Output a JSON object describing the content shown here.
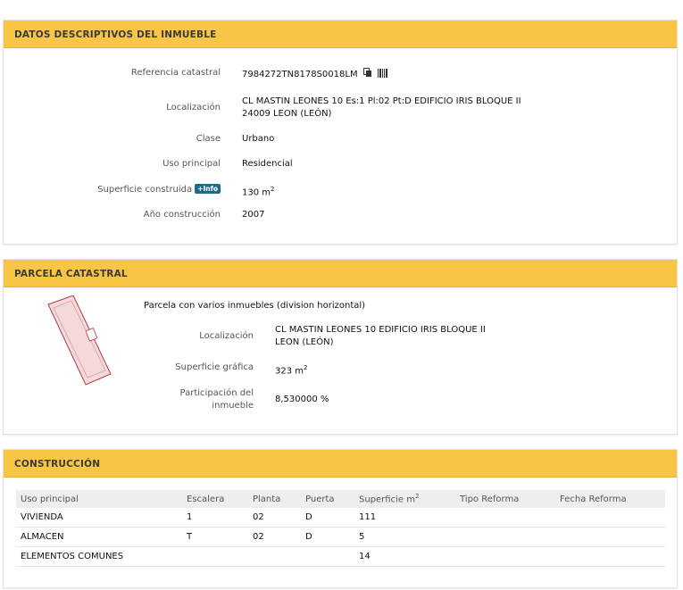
{
  "datos": {
    "title": "DATOS DESCRIPTIVOS DEL INMUEBLE",
    "ref_label": "Referencia catastral",
    "ref_value": "7984272TN8178S0018LM",
    "loc_label": "Localización",
    "loc_line1": "CL MASTIN LEONES 10 Es:1 Pl:02 Pt:D EDIFICIO IRIS BLOQUE II",
    "loc_line2": "24009 LEON (LEÓN)",
    "clase_label": "Clase",
    "clase_value": "Urbano",
    "uso_label": "Uso principal",
    "uso_value": "Residencial",
    "sup_label": "Superficie construida",
    "info_badge": "+Info",
    "sup_value": "130 m",
    "sup_unit_exp": "2",
    "anio_label": "Año construcción",
    "anio_value": "2007"
  },
  "parcela": {
    "title": "PARCELA CATASTRAL",
    "subtitle": "Parcela con varios inmuebles (division horizontal)",
    "loc_label": "Localización",
    "loc_line1": "CL MASTIN LEONES 10 EDIFICIO IRIS BLOQUE II",
    "loc_line2": "LEON (LEÓN)",
    "sup_label": "Superficie gráfica",
    "sup_value": "323 m",
    "sup_unit_exp": "2",
    "part_label_1": "Participación del",
    "part_label_2": "inmueble",
    "part_value": "8,530000 %"
  },
  "construccion": {
    "title": "CONSTRUCCIÓN",
    "headers": [
      "Uso principal",
      "Escalera",
      "Planta",
      "Puerta",
      "Superficie m",
      "Tipo Reforma",
      "Fecha Reforma"
    ],
    "header_sup_exp": "2",
    "rows": [
      [
        "VIVIENDA",
        "1",
        "02",
        "D",
        "111",
        "",
        ""
      ],
      [
        "ALMACEN",
        "T",
        "02",
        "D",
        "5",
        "",
        ""
      ],
      [
        "ELEMENTOS COMUNES",
        "",
        "",
        "",
        "14",
        "",
        ""
      ]
    ]
  },
  "icons": {
    "copy": "copy-icon",
    "barcode": "barcode-icon",
    "parcel_map": "parcel-map-icon"
  },
  "colors": {
    "header_bg": "#f9c544",
    "info_badge": "#1e6a8a",
    "parcel_fill": "#f5d9d9",
    "parcel_stroke": "#b8394a"
  }
}
